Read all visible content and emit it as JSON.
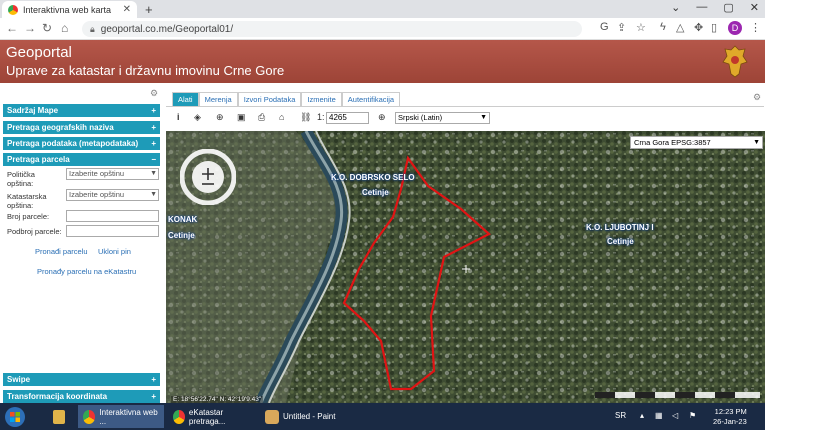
{
  "browser": {
    "tab_title": "Interaktivna web karta",
    "new_tab": "+",
    "url": "geoportal.co.me/Geoportal01/",
    "profile_initial": "D",
    "window_controls": [
      "⌄",
      "—",
      "▢",
      "✕"
    ]
  },
  "header": {
    "title": "Geoportal",
    "subtitle": "Uprave za katastar i državnu imovinu Crne Gore"
  },
  "sidebar": {
    "sections": [
      {
        "label": "Sadržaj Mape",
        "state": "+"
      },
      {
        "label": "Pretraga geografskih naziva",
        "state": "+"
      },
      {
        "label": "Pretraga podataka (metapodataka)",
        "state": "+"
      },
      {
        "label": "Pretraga parcela",
        "state": "−"
      }
    ],
    "parcel_form": {
      "politicka_label": "Politička opština:",
      "politicka_value": "Izaberite opštinu",
      "katastarska_label": "Katastarska opština:",
      "katastarska_value": "Izaberite opštinu",
      "broj_label": "Broj parcele:",
      "podbroj_label": "Podbroj parcele:",
      "find_link": "Pronađi parcelu",
      "remove_link": "Ukloni pin",
      "ekatastar_link": "Pronađy parcelu na eKatastru"
    },
    "bottom_sections": [
      {
        "label": "Swipe",
        "state": "+"
      },
      {
        "label": "Transformacija koordinata",
        "state": "+"
      }
    ]
  },
  "map_tabs": [
    "Alati",
    "Merenja",
    "Izvori Podataka",
    "Izmenite",
    "Autentifikacija"
  ],
  "toolbar": {
    "scale_prefix": "1:",
    "scale_value": "4265",
    "language": "Srpski (Latin)"
  },
  "map": {
    "crs": "Crna Gora EPSG:3857",
    "labels": [
      {
        "text": "K.O. DOBRSKO SELO"
      },
      {
        "text": "Cetinje"
      },
      {
        "text": "K.O. LJUBOTINJ I"
      },
      {
        "text": "Cetinje"
      },
      {
        "text": "KONAK"
      },
      {
        "text": "Cetinje"
      }
    ],
    "coordinates": "E: 18°56'22.74\"   N: 42°19'9.43\"",
    "parcel_color": "#e01414"
  },
  "taskbar": {
    "apps": [
      {
        "label": "Interaktivna web ..."
      },
      {
        "label": "eKatastar pretraga..."
      },
      {
        "label": "Untitled - Paint"
      }
    ],
    "tray_lang": "SR",
    "time": "12:23 PM",
    "date": "26-Jan-23"
  }
}
